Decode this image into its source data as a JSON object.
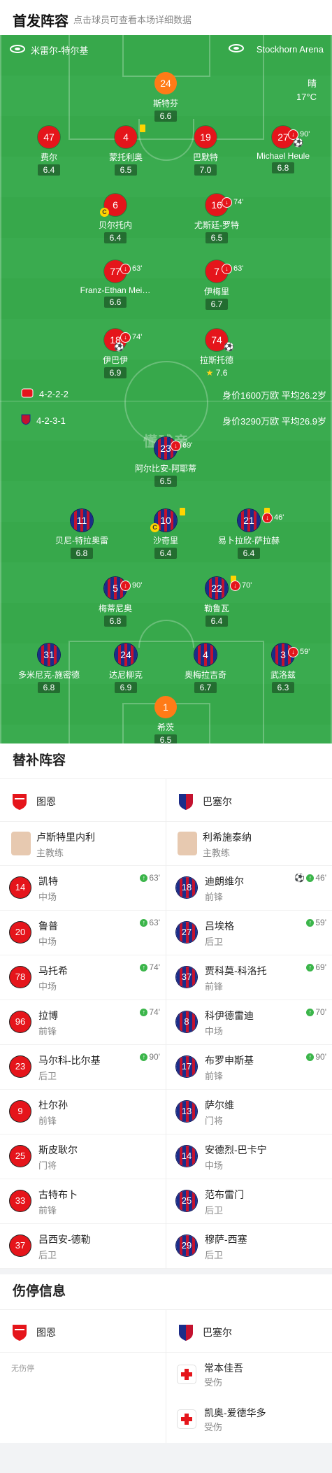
{
  "header": {
    "title": "首发阵容",
    "subtitle": "点击球员可查看本场详细数据"
  },
  "venue": {
    "home_stadium": "米雷尔-特尔基",
    "away_stadium": "Stockhorn Arena"
  },
  "weather": {
    "condition": "晴",
    "temperature": "17°C"
  },
  "watermark": "懂球帝",
  "home": {
    "formation": "4-2-2-2",
    "value": "身价1600万欧 平均26.2岁",
    "players": [
      {
        "num": "24",
        "name": "斯特芬",
        "rating": "6.6"
      },
      {
        "num": "47",
        "name": "费尔",
        "rating": "6.4"
      },
      {
        "num": "4",
        "name": "蒙托利奥",
        "rating": "6.5"
      },
      {
        "num": "19",
        "name": "巴默特",
        "rating": "7.0"
      },
      {
        "num": "27",
        "name": "Michael Heule",
        "rating": "6.8",
        "sub": "90'"
      },
      {
        "num": "6",
        "name": "贝尔托内",
        "rating": "6.4"
      },
      {
        "num": "16",
        "name": "尤斯廷-罗特",
        "rating": "6.5",
        "sub": "74'"
      },
      {
        "num": "77",
        "name": "Franz-Ethan Mei…",
        "rating": "6.6",
        "sub": "63'"
      },
      {
        "num": "7",
        "name": "伊梅里",
        "rating": "6.7",
        "sub": "63'"
      },
      {
        "num": "18",
        "name": "伊巴伊",
        "rating": "6.9",
        "sub": "74'"
      },
      {
        "num": "74",
        "name": "拉斯托德",
        "rating": "7.6"
      }
    ]
  },
  "away": {
    "formation": "4-2-3-1",
    "value": "身价3290万欧 平均26.9岁",
    "players": [
      {
        "num": "23",
        "name": "阿尔比安-阿耶蒂",
        "rating": "6.5",
        "sub": "69'"
      },
      {
        "num": "11",
        "name": "贝尼-特拉奥雷",
        "rating": "6.8"
      },
      {
        "num": "10",
        "name": "沙奇里",
        "rating": "6.4"
      },
      {
        "num": "21",
        "name": "易卜拉欣-萨拉赫",
        "rating": "6.4",
        "sub": "46'"
      },
      {
        "num": "5",
        "name": "梅蒂尼奥",
        "rating": "6.8",
        "sub": "90'"
      },
      {
        "num": "22",
        "name": "勒鲁瓦",
        "rating": "6.4",
        "sub": "70'"
      },
      {
        "num": "31",
        "name": "多米尼克-施密德",
        "rating": "6.8"
      },
      {
        "num": "24",
        "name": "达尼柳克",
        "rating": "6.9"
      },
      {
        "num": "4",
        "name": "奥梅拉吉奇",
        "rating": "6.7"
      },
      {
        "num": "3",
        "name": "武洛兹",
        "rating": "6.3",
        "sub": "59'"
      },
      {
        "num": "1",
        "name": "希茨",
        "rating": "6.5"
      }
    ]
  },
  "subs_section": {
    "title": "替补阵容",
    "home_team": "图恩",
    "away_team": "巴塞尔",
    "home_coach": {
      "name": "卢斯特里内利",
      "role": "主教练"
    },
    "away_coach": {
      "name": "利希施泰纳",
      "role": "主教练"
    },
    "home_subs": [
      {
        "num": "14",
        "name": "凯特",
        "pos": "中场",
        "in": "63'"
      },
      {
        "num": "20",
        "name": "鲁普",
        "pos": "中场",
        "in": "63'"
      },
      {
        "num": "78",
        "name": "马托希",
        "pos": "中场",
        "in": "74'"
      },
      {
        "num": "96",
        "name": "拉博",
        "pos": "前锋",
        "in": "74'"
      },
      {
        "num": "23",
        "name": "马尔科-比尔基",
        "pos": "后卫",
        "in": "90'"
      },
      {
        "num": "9",
        "name": "杜尔孙",
        "pos": "前锋",
        "in": ""
      },
      {
        "num": "25",
        "name": "斯皮耿尔",
        "pos": "门将",
        "in": ""
      },
      {
        "num": "33",
        "name": "古特布卜",
        "pos": "前锋",
        "in": ""
      },
      {
        "num": "37",
        "name": "吕西安-德勒",
        "pos": "后卫",
        "in": ""
      }
    ],
    "away_subs": [
      {
        "num": "18",
        "name": "迪朗维尔",
        "pos": "前锋",
        "in": "46'"
      },
      {
        "num": "27",
        "name": "吕埃格",
        "pos": "后卫",
        "in": "59'"
      },
      {
        "num": "37",
        "name": "贾科莫-科洛托",
        "pos": "前锋",
        "in": "69'"
      },
      {
        "num": "8",
        "name": "科伊德雷迪",
        "pos": "中场",
        "in": "70'"
      },
      {
        "num": "17",
        "name": "布罗申斯基",
        "pos": "前锋",
        "in": "90'"
      },
      {
        "num": "13",
        "name": "萨尔维",
        "pos": "门将",
        "in": ""
      },
      {
        "num": "14",
        "name": "安德烈-巴卡宁",
        "pos": "中场",
        "in": ""
      },
      {
        "num": "25",
        "name": "范布雷门",
        "pos": "后卫",
        "in": ""
      },
      {
        "num": "29",
        "name": "穆萨-西塞",
        "pos": "后卫",
        "in": ""
      }
    ]
  },
  "injury_section": {
    "title": "伤停信息",
    "home_team": "图恩",
    "away_team": "巴塞尔",
    "home_none": "无伤停",
    "away_list": [
      {
        "name": "常本佳吾",
        "status": "受伤"
      },
      {
        "name": "凯奥-爱德华多",
        "status": "受伤"
      }
    ]
  },
  "colors": {
    "pitch": "#3aab4f",
    "home_kit": "#e5151b",
    "away_kit_blue": "#1a2d8a",
    "away_kit_red": "#c3122f",
    "keeper": "#ff7b17"
  }
}
